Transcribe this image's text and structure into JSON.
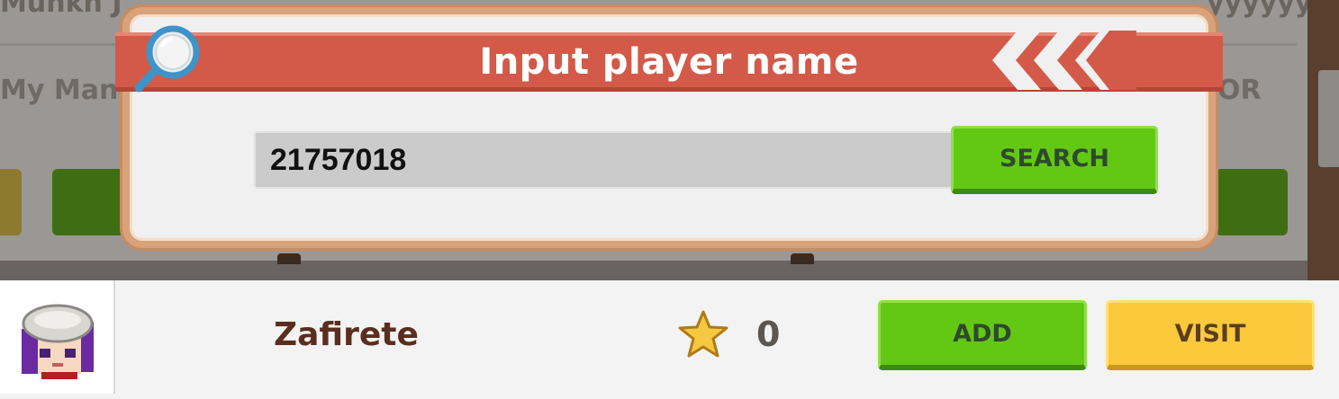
{
  "background": {
    "heading_left": "Munkh J",
    "heading_right": "yyyyyy",
    "subtitle_left": "My Mano",
    "subtitle_right": "OR"
  },
  "dialog": {
    "title": "Input player name",
    "search_value": "21757018",
    "search_button": "SEARCH",
    "icons": {
      "header": "magnifier-icon",
      "decor": "chevron-arrows-icon"
    }
  },
  "result": {
    "player_name": "Zafirete",
    "stars": "0",
    "add_button": "ADD",
    "visit_button": "VISIT",
    "icons": {
      "avatar": "player-avatar",
      "star": "star-icon"
    }
  },
  "colors": {
    "ribbon": "#d35a49",
    "dialog_border": "#d8a37a",
    "green_button": "#63c814",
    "yellow_button": "#fcc93c",
    "name_text": "#5a2e1e"
  }
}
